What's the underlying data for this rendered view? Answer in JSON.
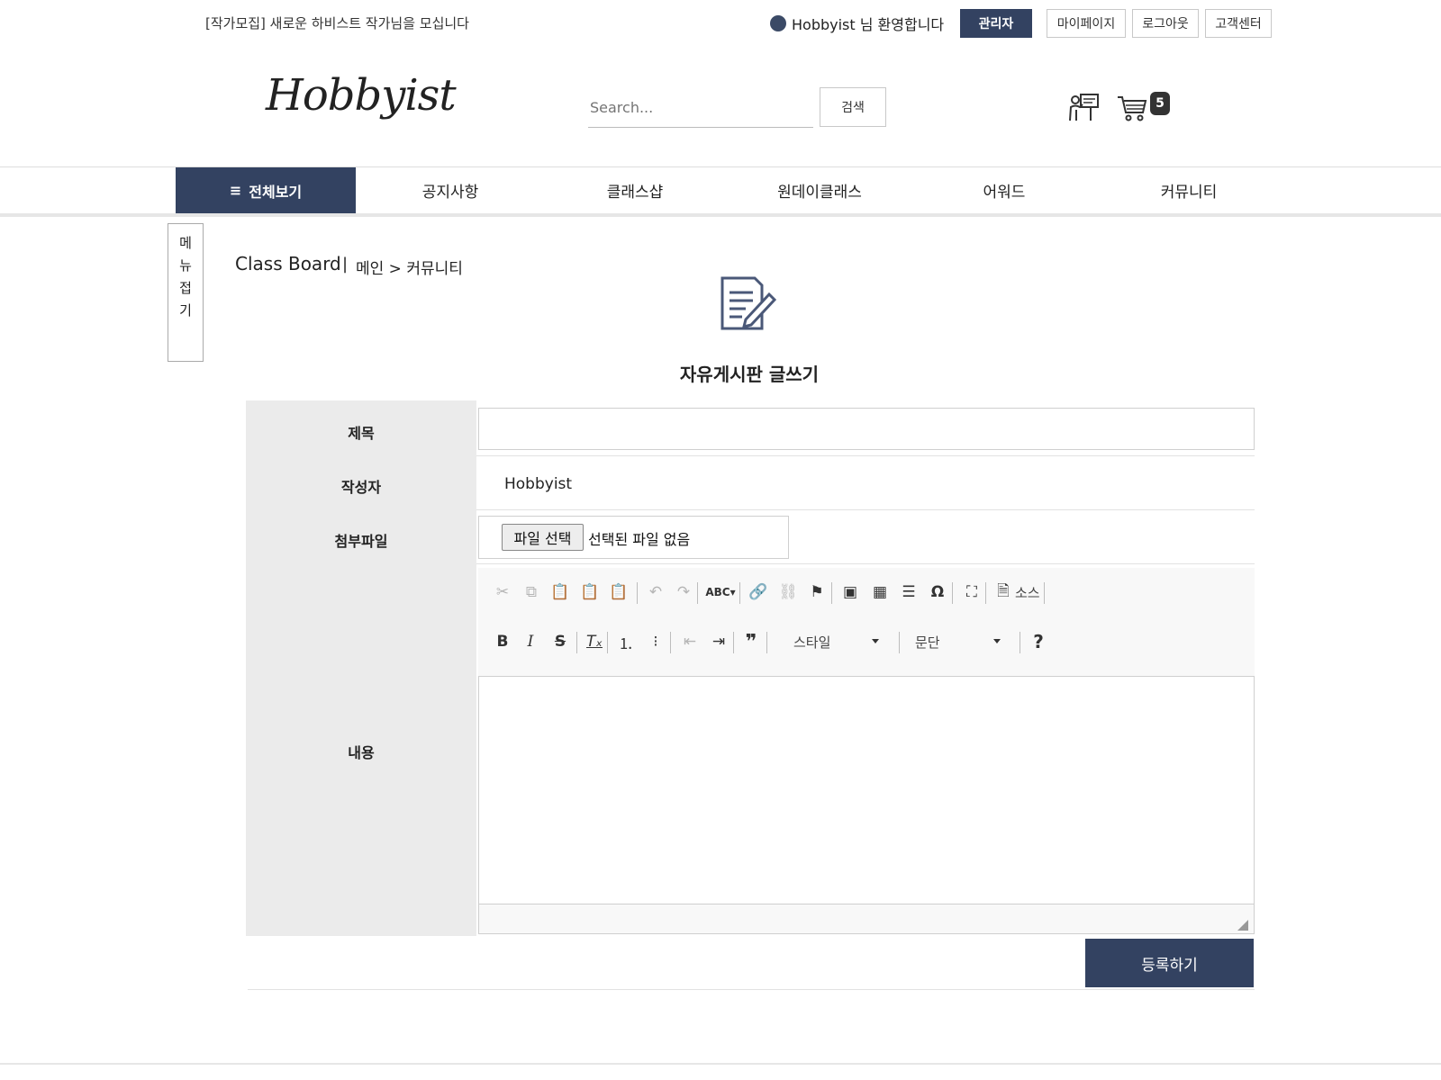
{
  "topbar": {
    "notice": "[작가모집] 새로운 하비스트 작가님을 모십니다",
    "welcome": "Hobbyist 님 환영합니다",
    "buttons": {
      "admin": "관리자",
      "mypage": "마이페이지",
      "logout": "로그아웃",
      "support": "고객센터"
    }
  },
  "header": {
    "logo": "Hobbyist",
    "search_placeholder": "Search...",
    "search_button": "검색",
    "cart_count": "5"
  },
  "nav": {
    "all": "전체보기",
    "items": [
      "공지사항",
      "클래스샵",
      "원데이클래스",
      "어워드",
      "커뮤니티"
    ]
  },
  "side": {
    "fold_chars": [
      "메",
      "뉴",
      "접",
      "기"
    ]
  },
  "breadcrumb": {
    "title": "Class Board",
    "separator": "|",
    "path": "메인 > 커뮤니티"
  },
  "page": {
    "title": "자유게시판 글쓰기"
  },
  "form": {
    "labels": {
      "title": "제목",
      "author": "작성자",
      "attachment": "첨부파일",
      "content": "내용"
    },
    "author_value": "Hobbyist",
    "file_button": "파일 선택",
    "file_status": "선택된 파일 없음",
    "submit": "등록하기"
  },
  "editor": {
    "style_combo": "스타일",
    "format_combo": "문단",
    "source_label": "소스",
    "toolbar_row1": [
      "cut-icon",
      "copy-icon",
      "paste-icon",
      "paste-text-icon",
      "paste-word-icon",
      "undo-icon",
      "redo-icon",
      "spellcheck-icon",
      "link-icon",
      "unlink-icon",
      "anchor-icon",
      "image-icon",
      "table-icon",
      "horizontal-rule-icon",
      "special-char-icon",
      "maximize-icon",
      "source-icon"
    ],
    "toolbar_row2": [
      "bold-icon",
      "italic-icon",
      "strike-icon",
      "remove-format-icon",
      "numbered-list-icon",
      "bulleted-list-icon",
      "outdent-icon",
      "indent-icon",
      "blockquote-icon",
      "help-icon"
    ]
  },
  "colors": {
    "accent": "#334261",
    "label_bg": "#ebebeb"
  }
}
